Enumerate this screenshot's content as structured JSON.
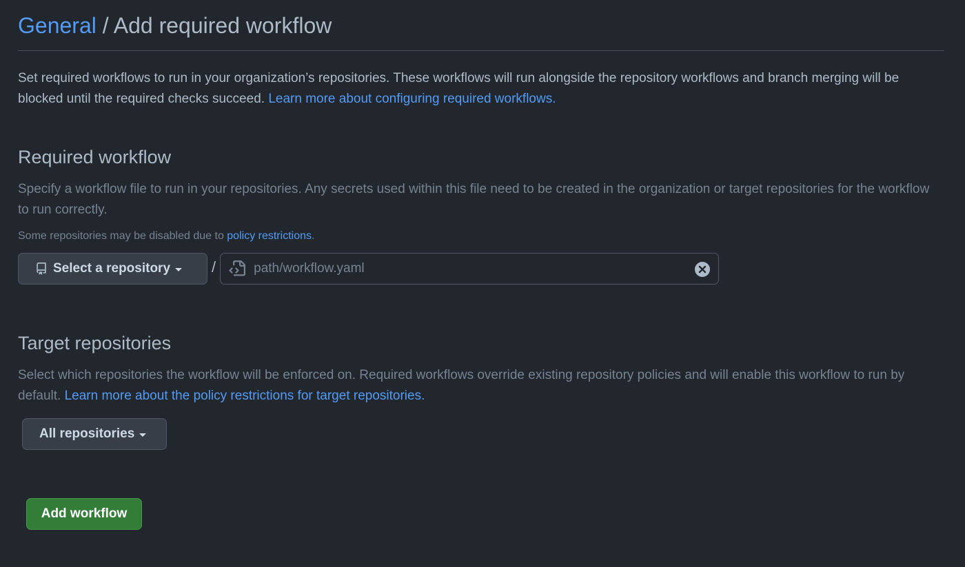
{
  "breadcrumb": {
    "parent": "General",
    "separator": " / ",
    "current": "Add required workflow"
  },
  "intro": {
    "text": "Set required workflows to run in your organization’s repositories. These workflows will run alongside the repository workflows and branch merging will be blocked until the required checks succeed. ",
    "link": "Learn more about configuring required workflows."
  },
  "required_workflow": {
    "title": "Required workflow",
    "description": "Specify a workflow file to run in your repositories. Any secrets used within this file need to be created in the organization or target repositories for the workflow to run correctly.",
    "note_text": "Some repositories may be disabled due to ",
    "note_link": "policy restrictions",
    "note_end": ".",
    "repo_button_label": "Select a repository",
    "path_separator": "/",
    "path_placeholder": "path/workflow.yaml",
    "path_value": ""
  },
  "target_repositories": {
    "title": "Target repositories",
    "description": "Select which repositories the workflow will be enforced on. Required workflows override existing repository policies and will enable this workflow to run by default. ",
    "link": "Learn more about the policy restrictions for target repositories.",
    "dropdown_label": "All repositories"
  },
  "actions": {
    "add_label": "Add workflow"
  },
  "colors": {
    "background": "#22272e",
    "link": "#539bf5",
    "primary_button": "#347d39",
    "muted_text": "#768390"
  },
  "icons": {
    "repo": "repo-icon",
    "file": "file-code-icon",
    "clear": "x-circle-fill-icon",
    "caret": "triangle-down-icon"
  }
}
